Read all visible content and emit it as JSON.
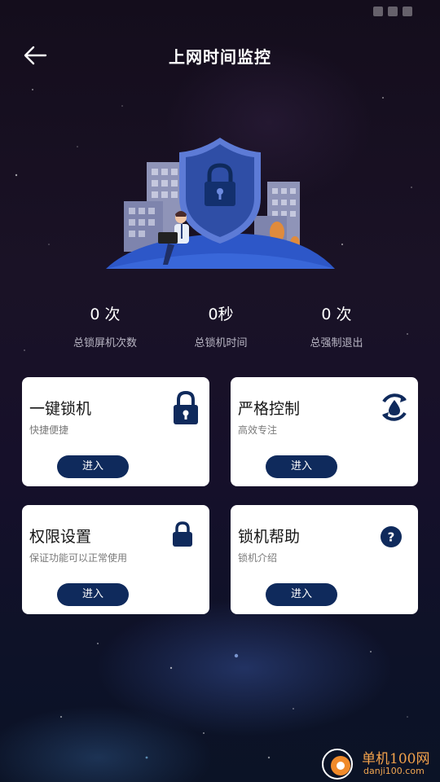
{
  "header": {
    "title": "上网时间监控"
  },
  "stats": [
    {
      "value": "0 次",
      "label": "总锁屏机次数"
    },
    {
      "value": "0秒",
      "label": "总锁机时间"
    },
    {
      "value": "0 次",
      "label": "总强制退出"
    }
  ],
  "cards": [
    {
      "title": "一键锁机",
      "subtitle": "快捷便捷",
      "button": "进入",
      "icon": "padlock-icon"
    },
    {
      "title": "严格控制",
      "subtitle": "高效专注",
      "button": "进入",
      "icon": "cycle-drop-icon"
    },
    {
      "title": "权限设置",
      "subtitle": "保证功能可以正常使用",
      "button": "进入",
      "icon": "lock-icon"
    },
    {
      "title": "锁机帮助",
      "subtitle": "锁机介绍",
      "button": "进入",
      "icon": "help-icon"
    }
  ],
  "watermark": {
    "name": "单机100网",
    "domain": "danji100.com"
  },
  "colors": {
    "accent": "#0f2a5c",
    "card_bg": "#ffffff",
    "shield": "#2f4ea6",
    "watermark": "#f3a24b"
  }
}
